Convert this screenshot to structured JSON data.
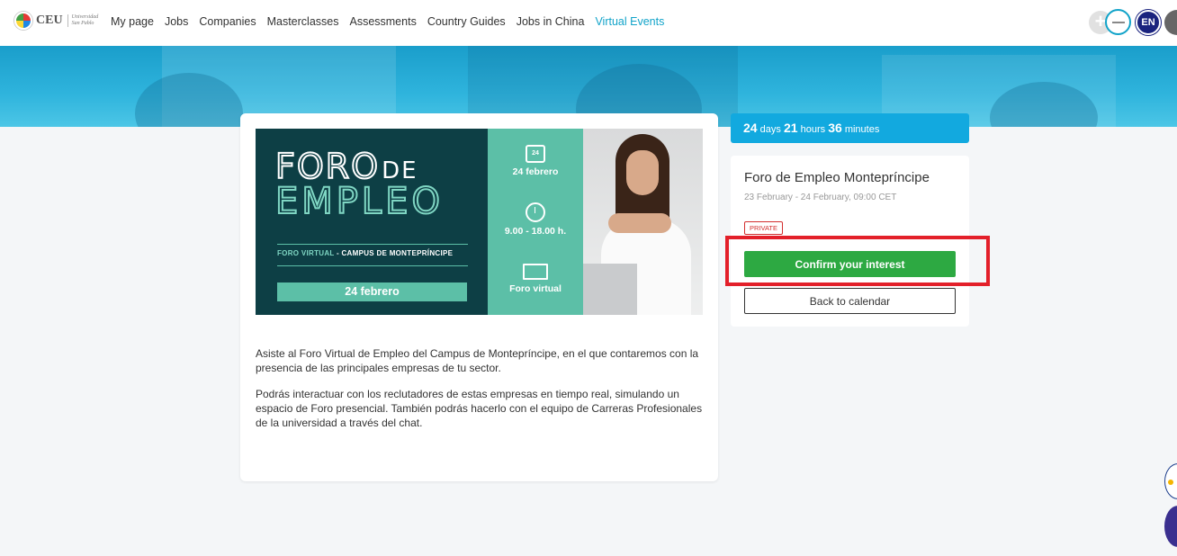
{
  "header": {
    "logo_text": "CEU",
    "logo_sub": "Universidad San Pablo",
    "nav": [
      "My page",
      "Jobs",
      "Companies",
      "Masterclasses",
      "Assessments",
      "Country Guides",
      "Jobs in China",
      "Virtual Events"
    ],
    "active_nav": "Virtual Events",
    "lang": "EN",
    "plus_icon": "+"
  },
  "poster": {
    "foro": "FORO",
    "de": "DE",
    "empleo": "EMPLEO",
    "sub_prefix": "FORO VIRTUAL",
    "sub_suffix": "- CAMPUS DE MONTEPRÍNCIPE",
    "date_bar": "24 febrero",
    "calendar_day": "24",
    "date_label": "24 febrero",
    "time_label": "9.00 - 18.00 h.",
    "mode_label": "Foro virtual"
  },
  "description": {
    "p1": "Asiste al Foro Virtual de Empleo del Campus de Montepríncipe, en el que contaremos con la presencia de las principales empresas de tu sector.",
    "p2": "Podrás interactuar con los reclutadores de estas empresas en tiempo real, simulando un espacio de Foro presencial. También podrás hacerlo con el equipo de Carreras Profesionales de la universidad a través del chat."
  },
  "countdown": {
    "days": "24",
    "days_label": "days",
    "hours": "21",
    "hours_label": "hours",
    "minutes": "36",
    "minutes_label": "minutes"
  },
  "event": {
    "title": "Foro de Empleo Montepríncipe",
    "date": "23 February - 24 February, 09:00 CET",
    "badge": "PRIVATE",
    "confirm_label": "Confirm your interest",
    "back_label": "Back to calendar"
  },
  "colors": {
    "accent": "#11a3c9",
    "countdown_bg": "#12a9df",
    "confirm_bg": "#2da942",
    "highlight": "#e3202a",
    "badge": "#d32f2f"
  }
}
